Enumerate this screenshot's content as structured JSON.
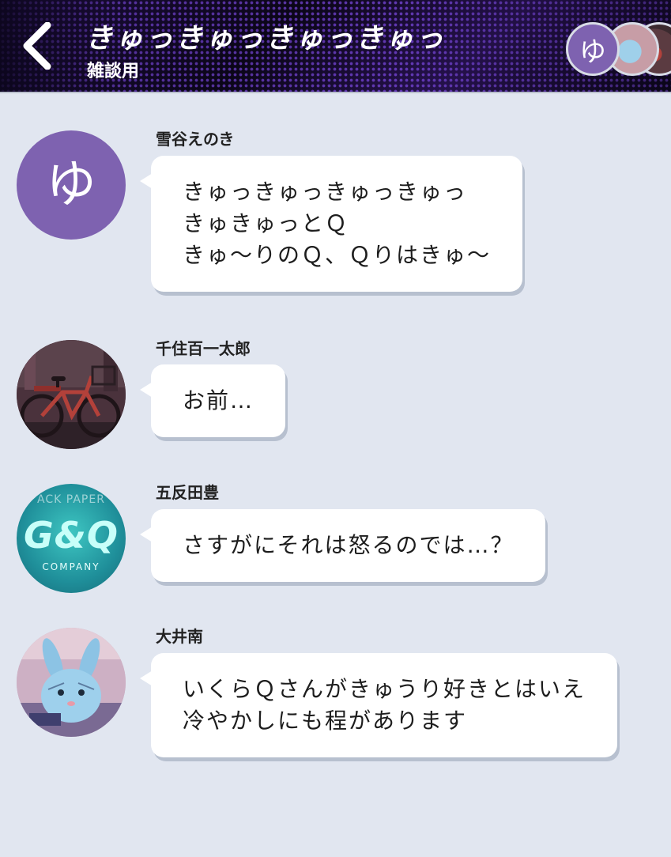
{
  "header": {
    "title": "きゅっきゅっきゅっきゅっ",
    "subtitle": "雑談用",
    "member_avatars": [
      {
        "glyph": "ゆ"
      },
      {
        "image": "bunny-plush"
      },
      {
        "image": "red-bicycle"
      }
    ]
  },
  "messages": [
    {
      "sender": "雪谷えのき",
      "avatar_glyph": "ゆ",
      "lines": [
        "きゅっきゅっきゅっきゅっ",
        "きゅきゅっとＱ",
        "きゅ～りのＱ、Ｑりはきゅ～"
      ]
    },
    {
      "sender": "千住百一太郎",
      "avatar_image": "red-bicycle",
      "lines": [
        "お前…"
      ]
    },
    {
      "sender": "五反田豊",
      "avatar_image": "gq-company-logo",
      "avatar_text": {
        "top": "ACK PAPER",
        "logo": "G&Q",
        "bottom": "COMPANY"
      },
      "lines": [
        "さすがにそれは怒るのでは…？"
      ]
    },
    {
      "sender": "大井南",
      "avatar_image": "blue-bunny-plush",
      "lines": [
        "いくらＱさんがきゅうり好きとはいえ",
        "冷やかしにも程があります"
      ]
    }
  ],
  "colors": {
    "background": "#e1e6f0",
    "bubble": "#ffffff",
    "avatar_purple": "#7e62b0",
    "header_bg": "#0b0618"
  }
}
